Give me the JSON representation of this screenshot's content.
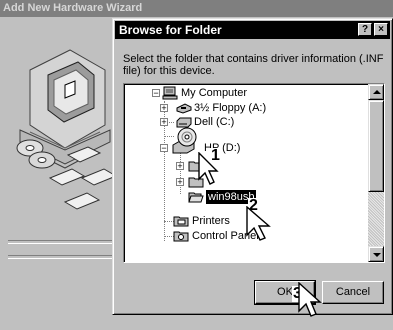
{
  "wizard": {
    "title": "Add New Hardware Wizard"
  },
  "dialog": {
    "title": "Browse for Folder",
    "help_label": "?",
    "close_label": "×",
    "instruction": "Select the folder that contains driver information (.INF file) for this device.",
    "ok_label": "OK",
    "cancel_label": "Cancel"
  },
  "tree": {
    "items": [
      {
        "label": "My Computer",
        "expander": "−"
      },
      {
        "label": "3½ Floppy (A:)",
        "expander": "+"
      },
      {
        "label": "Dell (C:)",
        "expander": "+"
      },
      {
        "label": "HP (D:)",
        "expander": "−"
      },
      {
        "label": "",
        "expander": "+"
      },
      {
        "label": "",
        "expander": "+"
      },
      {
        "label": "win98usb",
        "expander": ""
      },
      {
        "label": "Printers",
        "expander": ""
      },
      {
        "label": "Control Panel",
        "expander": ""
      }
    ]
  },
  "callouts": [
    {
      "number": "1"
    },
    {
      "number": "2"
    },
    {
      "number": "3"
    }
  ]
}
